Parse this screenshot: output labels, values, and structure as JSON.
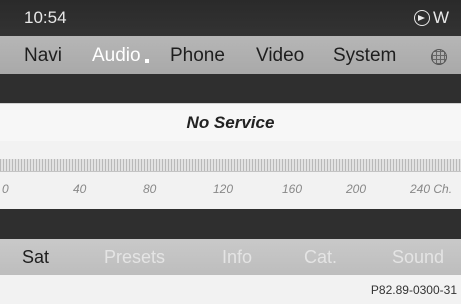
{
  "status": {
    "time": "10:54",
    "heading": "W",
    "heading_icon": "compass-arrow-icon"
  },
  "main_menu": {
    "items": [
      {
        "label": "Navi"
      },
      {
        "label": "Audio"
      },
      {
        "label": "Phone"
      },
      {
        "label": "Video"
      },
      {
        "label": "System"
      }
    ],
    "active": "Audio",
    "extra_icon": "globe-icon"
  },
  "service": {
    "text": "No Service"
  },
  "channel_scale": {
    "labels": [
      "0",
      "40",
      "80",
      "120",
      "160",
      "200",
      "240 Ch."
    ]
  },
  "bottom_menu": {
    "items": [
      {
        "label": "Sat"
      },
      {
        "label": "Presets"
      },
      {
        "label": "Info"
      },
      {
        "label": "Cat."
      },
      {
        "label": "Sound"
      }
    ],
    "active": "Sat"
  },
  "footer": {
    "code": "P82.89-0300-31"
  }
}
